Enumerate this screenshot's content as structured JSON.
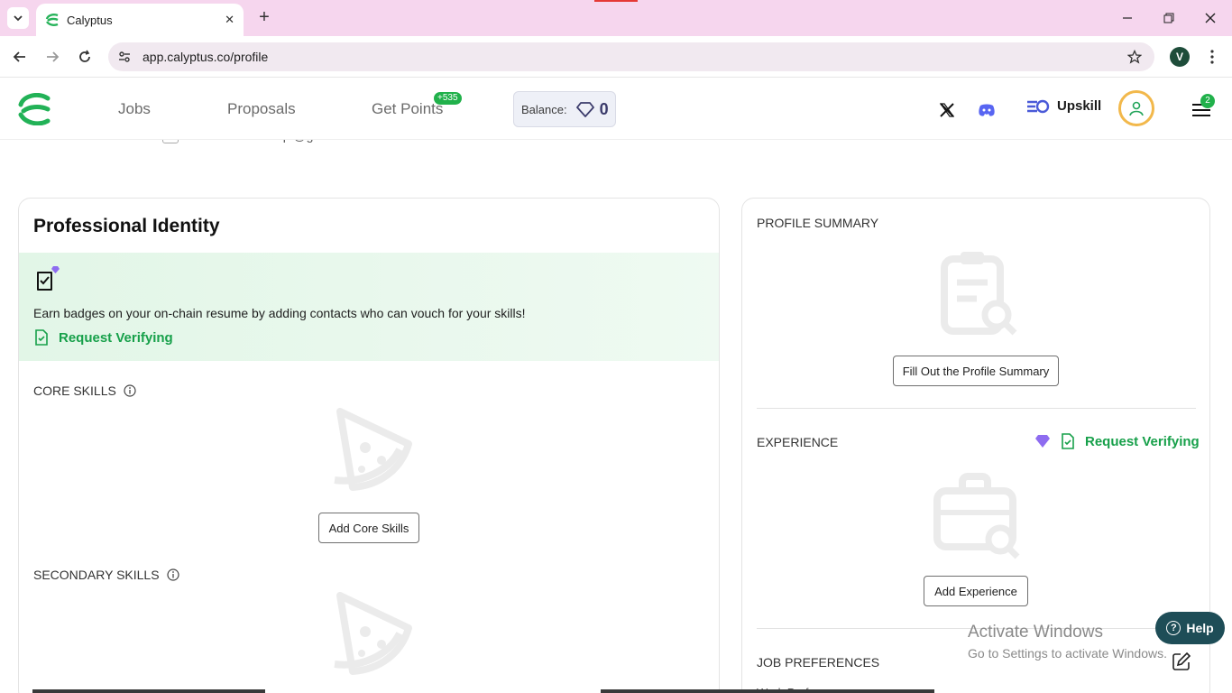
{
  "browser": {
    "tab_title": "Calyptus",
    "url": "app.calyptus.co/profile",
    "profile_initial": "V"
  },
  "header": {
    "nav": {
      "jobs": "Jobs",
      "proposals": "Proposals",
      "get_points": "Get Points"
    },
    "points_badge": "+535",
    "balance_label": "Balance:",
    "balance_value": "0",
    "upskill": "Upskill",
    "menu_badge": "2"
  },
  "clipped_row": {
    "email": "victoressionscript@gmail.com"
  },
  "professional_identity": {
    "title": "Professional Identity",
    "banner_text": "Earn badges on your on-chain resume by adding contacts who can vouch for your skills!",
    "request_verifying": "Request Verifying",
    "core_skills_label": "CORE SKILLS",
    "add_core_skills": "Add Core Skills",
    "secondary_skills_label": "SECONDARY SKILLS"
  },
  "right_panel": {
    "profile_summary_label": "PROFILE SUMMARY",
    "fill_summary_button": "Fill Out the Profile Summary",
    "experience_label": "EXPERIENCE",
    "experience_request_verifying": "Request Verifying",
    "add_experience_button": "Add Experience",
    "job_preferences_label": "JOB PREFERENCES",
    "work_pref_row": "Work Preferences"
  },
  "overlay": {
    "help": "Help",
    "activate_title": "Activate Windows",
    "activate_sub": "Go to Settings to activate Windows."
  },
  "colors": {
    "accent_green": "#17a04a",
    "tabbar_pink": "#f6d6ee",
    "banner_green": "#e2f6e7",
    "help_bg": "#1e4d57",
    "gem_purple": "#8e6cf0"
  }
}
